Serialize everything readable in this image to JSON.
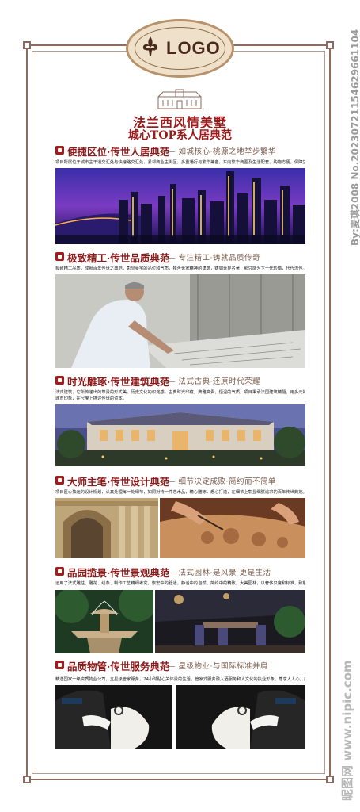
{
  "logo": {
    "text": "LOGO"
  },
  "header": {
    "title": "法兰西风情美墅",
    "subtitle": "城心TOP系人居典范"
  },
  "sections": [
    {
      "heading": "便捷区位·传世人居典范",
      "tagline": "—— 如城核心·桃源之地举步繁华",
      "body": [
        "项目所属位于城市主干道交汇处与快速路交汇处，紧邻商业主街区，多重通行与繁华兼备，东向繁华商圈及生活配套，购物方便，保障生活服务。"
      ],
      "icon": "location-icon"
    },
    {
      "heading": "极致精工·传世品质典范",
      "tagline": "—— 专注精工·铸就品质传奇",
      "body": [
        "极致精工品质，成就百年传世之典范，彰显豪宅的品位和气质，独含世家精神的建筑，铸如世界名著，那只能为下一代珍惜，代代流传。"
      ],
      "icon": "crown-icon"
    },
    {
      "heading": "时光雕琢·传世建筑典范",
      "tagline": "—— 法式古典·还原时代荣耀",
      "body": [
        "法式建筑，它所传递出的尊贵的形式美，历史文化的积淀感，古典时光印痕，典雅高贵，恒温的气质。项目秉承法国建筑精髓，用多元的远见塑造豪宅的",
        "城市印象，在尺度上描述传世的资本。"
      ],
      "icon": "building-icon"
    },
    {
      "heading": "大师主笔·传世设计典范",
      "tagline": "—— 细节决定成败·简约而不简单",
      "body": [
        "项目匠心独运的设计规划，认真处理每一处细节，如同对待一件艺术品，精心雕琢，悉心打造，在细节上彰显细腻追求的百年传世典范。"
      ],
      "icon": "compass-icon"
    },
    {
      "heading": "品园揽景·传世景观典范",
      "tagline": "—— 法式园林·是风景 更是生活",
      "body": [
        "运用了法式雕柱、雕花、线条、制作工艺精细考究，恢宏中的舒适，静谧中的自然。简约中的精致，大美园林，以奢侈只度和标准，致敬建城。"
      ],
      "icon": "garden-icon"
    },
    {
      "heading": "品质物管·传世服务典范",
      "tagline": "—— 星级物业·与国际标准并肩",
      "body": [
        "精选国家一级资质物业公司，五星级管家服务，24小时贴心关怀贵的生活，管家式服务融入酒服务和人文化的执业形象，尊享人人心，广受赞誉。"
      ],
      "icon": "service-icon"
    }
  ],
  "watermark": {
    "side_text": "By:麦琪2008 No.20230721154629661104",
    "site_logo": "昵图网 www.nipic.com"
  },
  "colors": {
    "accent": "#9b1a1a",
    "frame": "#8d6b5f",
    "logo_bg": "#efe1c9",
    "logo_border": "#b8926b"
  }
}
